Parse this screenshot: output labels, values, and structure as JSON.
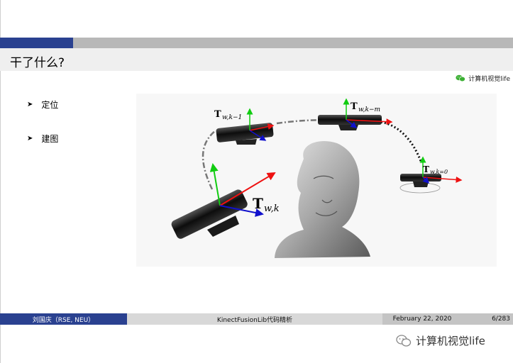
{
  "slide": {
    "title": "干了什么?",
    "bullets": [
      "定位",
      "建图"
    ]
  },
  "wechat_tag": {
    "icon": "wechat-icon",
    "label": "计算机视觉life"
  },
  "figure": {
    "pose_labels": [
      "T_{w,k-1}",
      "T_{w,k-m}",
      "T_{w,k=0}",
      "T_{w,k}"
    ],
    "device": "kinect-sensor",
    "subject": "reconstructed-face-mesh"
  },
  "footer": {
    "author": "刘国庆（RSE, NEU）",
    "title": "KinectFusionLib代码精析",
    "date": "February 22, 2020",
    "page": "6/283"
  },
  "watermark": {
    "icon": "wechat-icon",
    "label": "计算机视觉life"
  },
  "colors": {
    "accent_blue": "#2a4190",
    "bar_gray": "#b8b8b8",
    "title_band": "#efefef"
  }
}
